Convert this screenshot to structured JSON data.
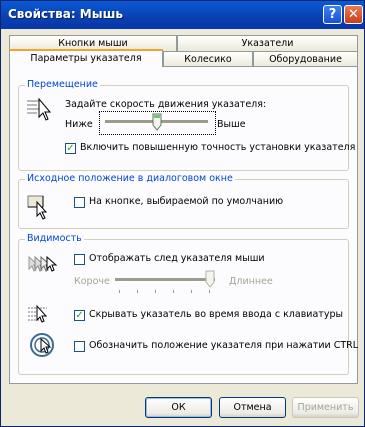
{
  "window": {
    "title": "Свойства: Мышь",
    "help_glyph": "?",
    "close_glyph": "✕"
  },
  "tabs_back": [
    "Кнопки мыши",
    "Указатели"
  ],
  "tabs_front": [
    "Параметры указателя",
    "Колесико",
    "Оборудование"
  ],
  "movement": {
    "group_label": "Перемещение",
    "speed_label": "Задайте скорость движения указателя:",
    "low_label": "Ниже",
    "high_label": "Выше",
    "speed_fraction": 0.5,
    "precision_label": "Включить повышенную точность установки указателя",
    "precision_checked": true
  },
  "snap": {
    "group_label": "Исходное положение в диалоговом окне",
    "label": "На кнопке, выбираемой по умолчанию",
    "checked": false
  },
  "visibility": {
    "group_label": "Видимость",
    "trails_label": "Отображать след указателя мыши",
    "trails_checked": false,
    "short_label": "Короче",
    "long_label": "Длиннее",
    "trails_fraction": 1.0,
    "hide_label": "Скрывать указатель во время ввода с клавиатуры",
    "hide_checked": true,
    "ctrl_label": "Обозначить положение указателя при нажатии CTRL",
    "ctrl_checked": false
  },
  "buttons": {
    "ok": "ОК",
    "cancel": "Отмена",
    "apply": "Применить"
  },
  "check_glyph": "✓",
  "colors": {
    "title_bg": "#0a5ad8",
    "accent": "#0046d5",
    "tab_highlight": "#f5a22c",
    "check": "#21a121"
  }
}
